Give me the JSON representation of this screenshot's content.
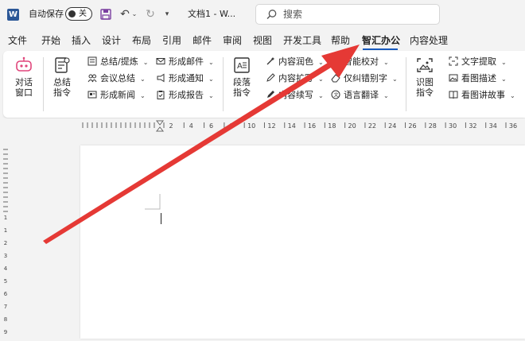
{
  "titlebar": {
    "app_logo": "W",
    "autosave_label": "自动保存",
    "autosave_state": "关",
    "doc_title": "文档1 - W...",
    "search_placeholder": "搜索"
  },
  "tabs": [
    "文件",
    "开始",
    "插入",
    "设计",
    "布局",
    "引用",
    "邮件",
    "审阅",
    "视图",
    "开发工具",
    "帮助",
    "智汇办公",
    "内容处理"
  ],
  "active_tab": "智汇办公",
  "ribbon": {
    "dialog": "对话\n窗口",
    "summary": "总结\n指令",
    "group1": [
      "总结/提炼",
      "会议总结",
      "形成新闻"
    ],
    "group2": [
      "形成邮件",
      "形成通知",
      "形成报告"
    ],
    "paragraph": "段落\n指令",
    "group3": [
      "内容润色",
      "内容扩写",
      "内容续写"
    ],
    "group4": [
      "智能校对",
      "仅纠错别字",
      "语言翻译"
    ],
    "image": "识图\n指令",
    "group5": [
      "文字提取",
      "看图描述",
      "看图讲故事"
    ]
  },
  "ruler": {
    "hlabels": [
      "2",
      "4",
      "6",
      "8",
      "10",
      "12",
      "14",
      "16",
      "18",
      "20",
      "22",
      "24",
      "26",
      "28",
      "30",
      "32",
      "34",
      "36"
    ],
    "vlabels": [
      "1",
      "1",
      "2",
      "3",
      "4",
      "5",
      "6",
      "7",
      "8",
      "9"
    ]
  },
  "colors": {
    "accent": "#185abd",
    "arrow": "#e53935"
  }
}
